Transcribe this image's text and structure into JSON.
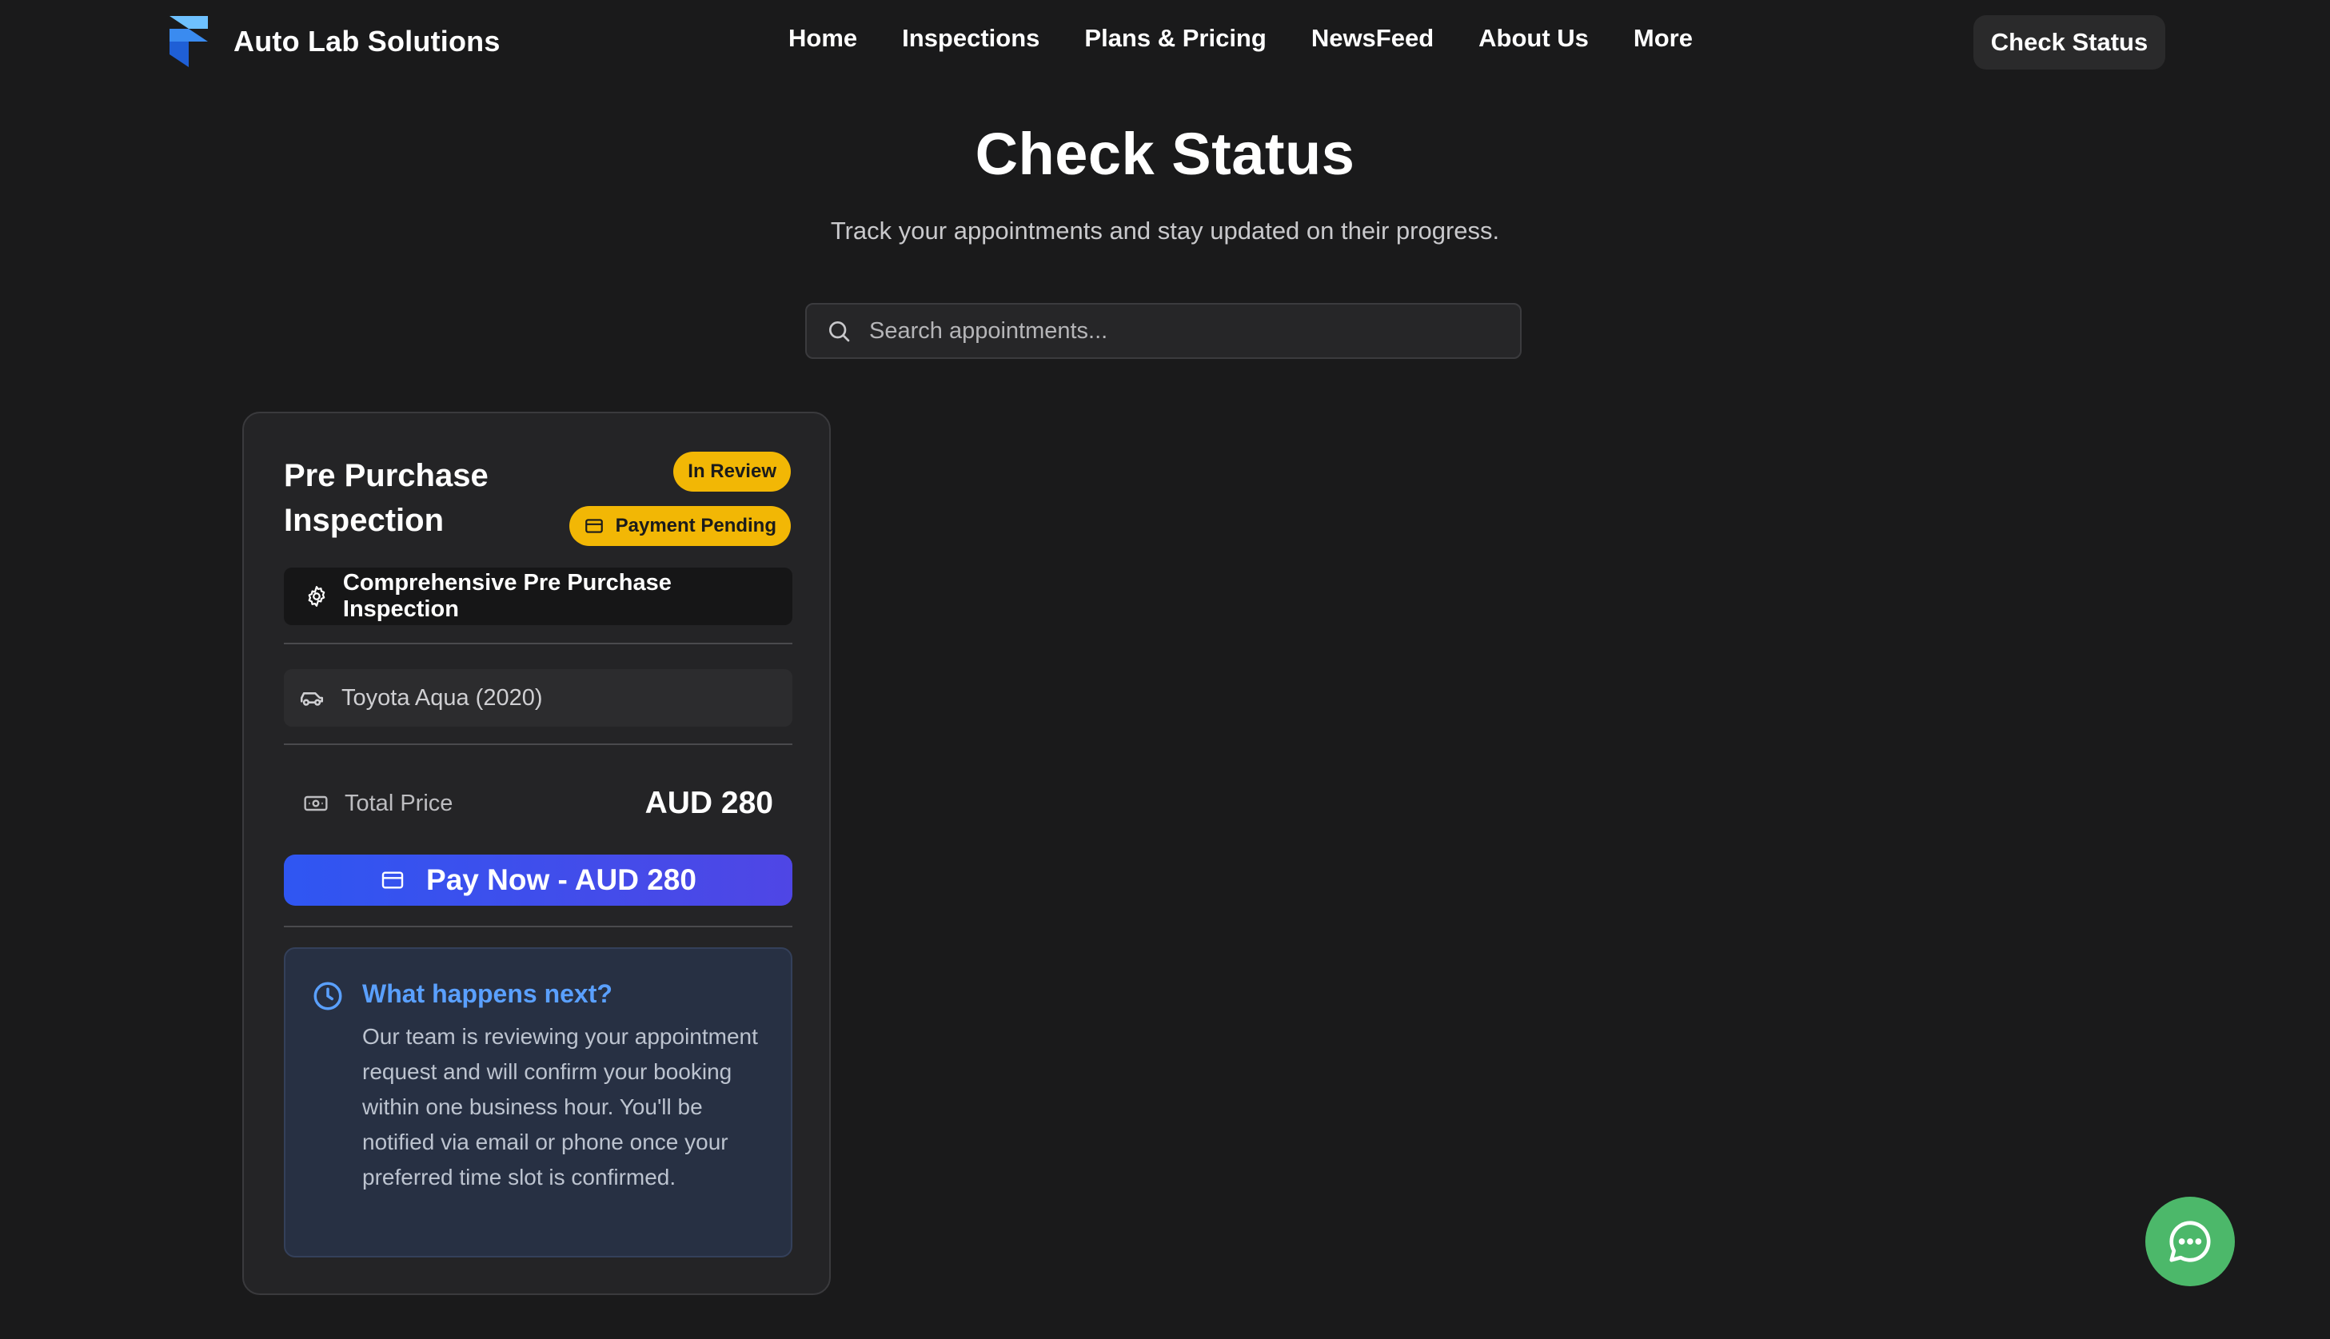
{
  "header": {
    "brand_name": "Auto Lab Solutions",
    "logo_icon": "framer-logo-icon",
    "nav": [
      "Home",
      "Inspections",
      "Plans & Pricing",
      "NewsFeed",
      "About Us",
      "More"
    ],
    "cta_label": "Check Status"
  },
  "hero": {
    "title": "Check Status",
    "subtitle": "Track your appointments and stay updated on their progress."
  },
  "search": {
    "placeholder": "Search appointments...",
    "value": "",
    "icon": "search-icon"
  },
  "appointment": {
    "title": "Pre Purchase Inspection",
    "status_badge": "In Review",
    "payment_badge": "Payment Pending",
    "service": "Comprehensive Pre Purchase Inspection",
    "vehicle": "Toyota Aqua (2020)",
    "price_label": "Total Price",
    "price_value": "AUD 280",
    "pay_button": "Pay Now - AUD 280",
    "info_title": "What happens next?",
    "info_text": "Our team is reviewing your appointment request and will confirm your booking within one business hour. You'll be notified via email or phone once your preferred time slot is confirmed."
  },
  "colors": {
    "background": "#1a1a1b",
    "badge_yellow": "#f2b705",
    "pay_button": "#3b52ec",
    "info_accent": "#5aa0ff",
    "chat_green": "#4cb86a"
  }
}
